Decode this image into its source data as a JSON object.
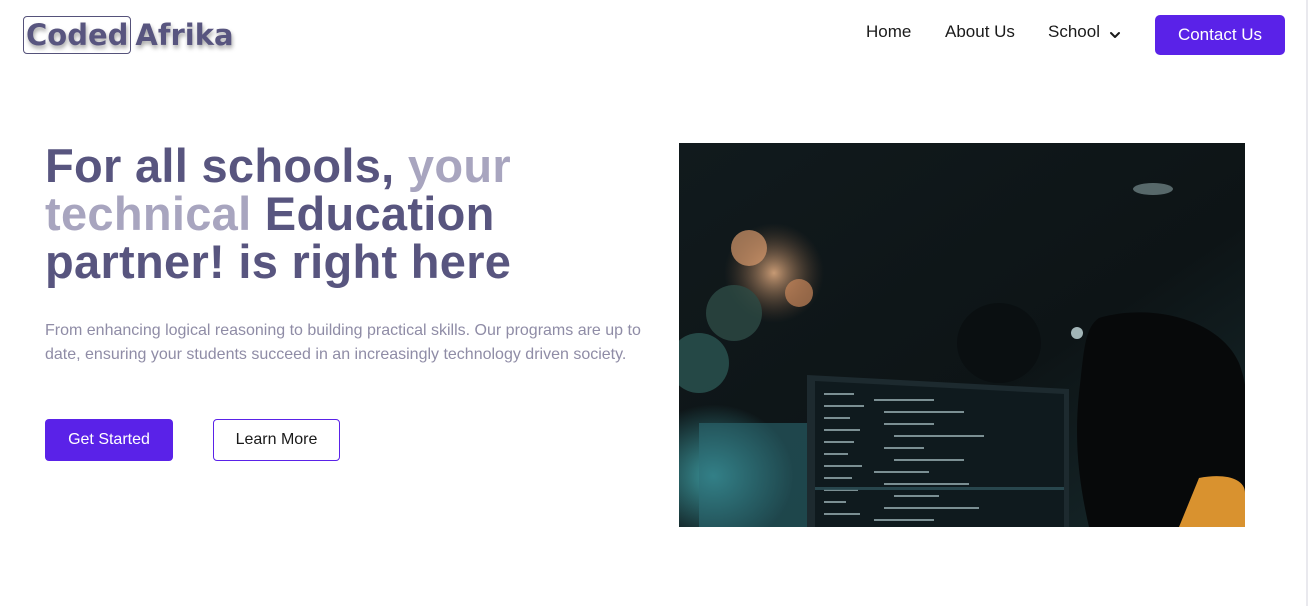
{
  "header": {
    "logo": {
      "boxed": "Coded",
      "rest": "Afrika"
    },
    "nav": {
      "home": "Home",
      "about": "About Us",
      "school": "School"
    },
    "contact_label": "Contact Us"
  },
  "hero": {
    "title_part1": "For all schools, ",
    "title_soft": "your technical",
    "title_part2": " Education partner! is right here",
    "description": "From enhancing logical reasoning to building practical skills. Our programs are up to date, ensuring your students succeed in an increasingly technology driven society.",
    "primary_button": "Get Started",
    "secondary_button": "Learn More"
  },
  "colors": {
    "accent": "#5a22e8",
    "heading": "#58557f",
    "heading_soft": "#a8a5bf",
    "body_text": "#8f8ca6"
  },
  "icons": {
    "school_dropdown": "chevron-down-icon"
  }
}
